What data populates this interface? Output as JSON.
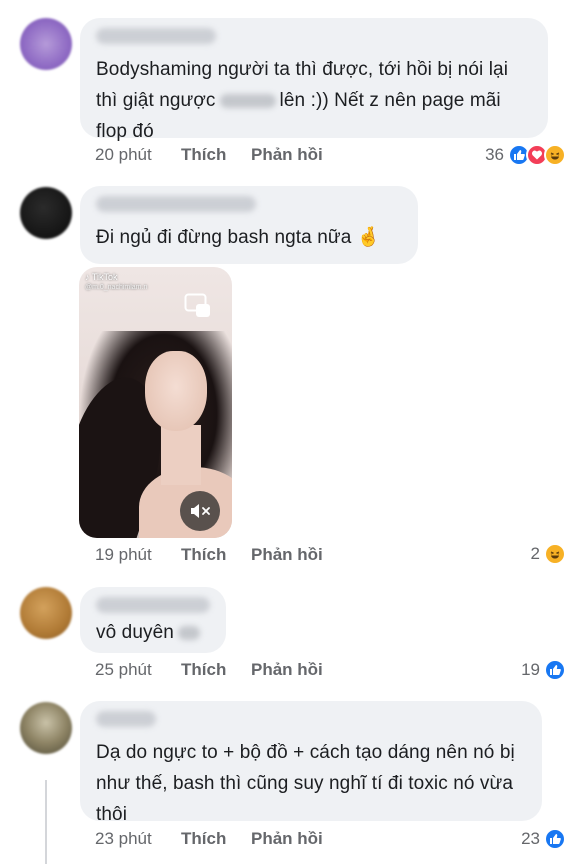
{
  "comments": [
    {
      "text_parts": [
        "Bodyshaming người ta thì được, tới hồi bị nói lại thì giật ngược",
        "lên :)) Nết z nên page mãi flop đó"
      ],
      "time": "20 phút",
      "like_label": "Thích",
      "reply_label": "Phản hồi",
      "reaction_count": "36",
      "reactions": [
        "like",
        "love",
        "haha"
      ]
    },
    {
      "text": "Đi ngủ đi đừng bash ngta nữa 🤞",
      "time": "19 phút",
      "like_label": "Thích",
      "reply_label": "Phản hồi",
      "reaction_count": "2",
      "reactions": [
        "haha"
      ],
      "video": {
        "app_label": "TikTok",
        "handle": "@m.0_nachimlam.n"
      }
    },
    {
      "text": "vô duyên",
      "time": "25 phút",
      "like_label": "Thích",
      "reply_label": "Phản hồi",
      "reaction_count": "19",
      "reactions": [
        "like"
      ]
    },
    {
      "text": "Dạ do ngực to + bộ đồ + cách tạo dáng nên nó bị như thế, bash thì cũng suy nghĩ tí đi toxic nó vừa thôi",
      "time": "23 phút",
      "like_label": "Thích",
      "reply_label": "Phản hồi",
      "reaction_count": "23",
      "reactions": [
        "like"
      ]
    }
  ],
  "colors": {
    "bubble": "#eff1f4",
    "meta_text": "#65676b",
    "like_blue": "#1877f2",
    "love_red": "#f33e58",
    "haha_yellow": "#f7b125"
  }
}
